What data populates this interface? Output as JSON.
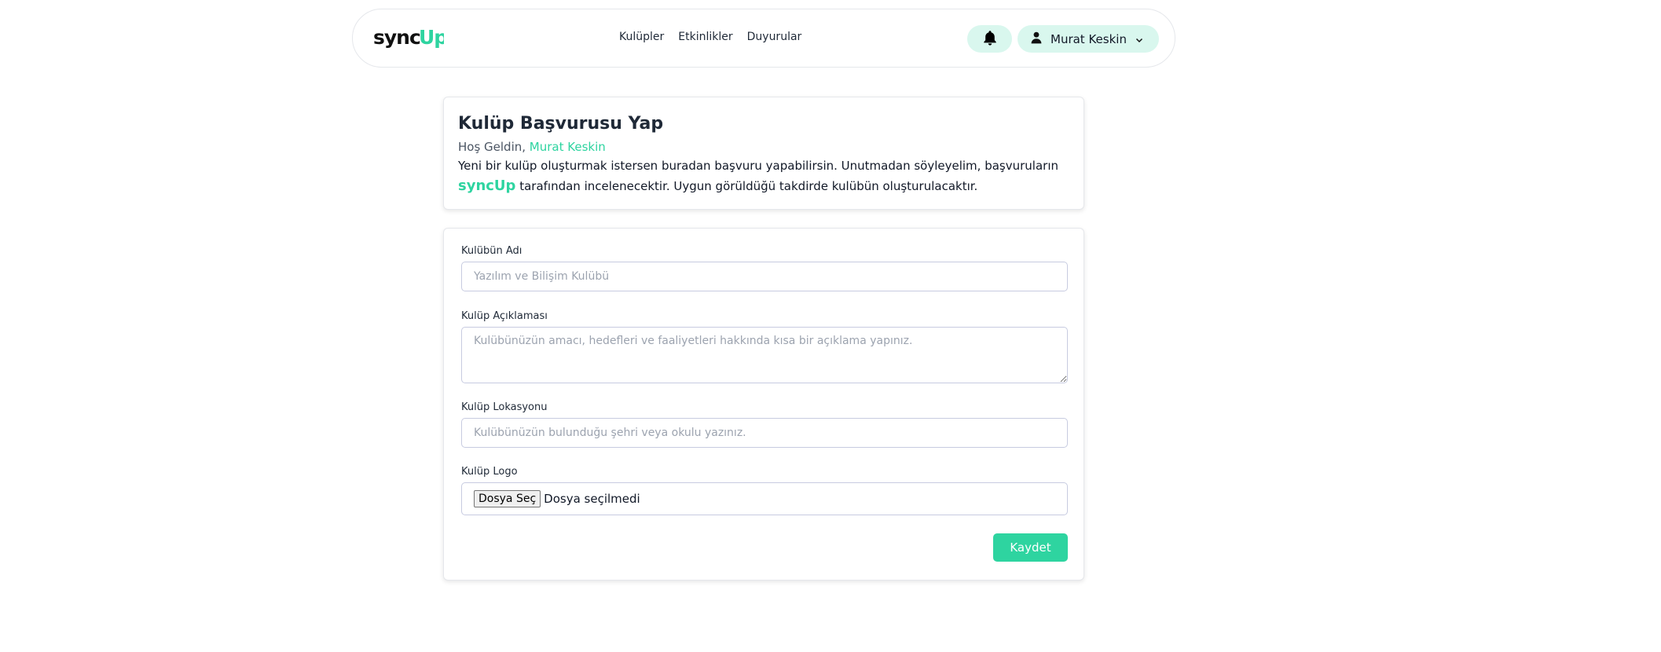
{
  "header": {
    "logo_text": "syncUp",
    "nav": [
      {
        "label": "Kulüpler"
      },
      {
        "label": "Etkinlikler"
      },
      {
        "label": "Duyurular"
      }
    ],
    "user_name": "Murat Keskin"
  },
  "intro": {
    "title": "Kulüp Başvurusu Yap",
    "welcome_prefix": "Hoş Geldin, ",
    "welcome_name": "Murat Keskin",
    "text_before": "Yeni bir kulüp oluşturmak istersen buradan başvuru yapabilirsin. Unutmadan söyleyelim, başvuruların ",
    "brand": "syncUp",
    "text_after": " tarafından incelenecektir. Uygun görüldüğü takdirde kulübün oluşturulacaktır."
  },
  "form": {
    "name_label": "Kulübün Adı",
    "name_placeholder": "Yazılım ve Bilişim Kulübü",
    "description_label": "Kulüp Açıklaması",
    "description_placeholder": "Kulübünüzün amacı, hedefleri ve faaliyetleri hakkında kısa bir açıklama yapınız.",
    "location_label": "Kulüp Lokasyonu",
    "location_placeholder": "Kulübünüzün bulunduğu şehri veya okulu yazınız.",
    "logo_label": "Kulüp Logo",
    "file_button": "Dosya Seç",
    "file_status": "Dosya seçilmedi",
    "save_label": "Kaydet"
  },
  "colors": {
    "accent": "#2ed4a0",
    "accent_light": "#d9f7ee"
  },
  "icons": {
    "bell": "bell-icon",
    "user": "user-icon",
    "chevron": "chevron-down-icon"
  }
}
